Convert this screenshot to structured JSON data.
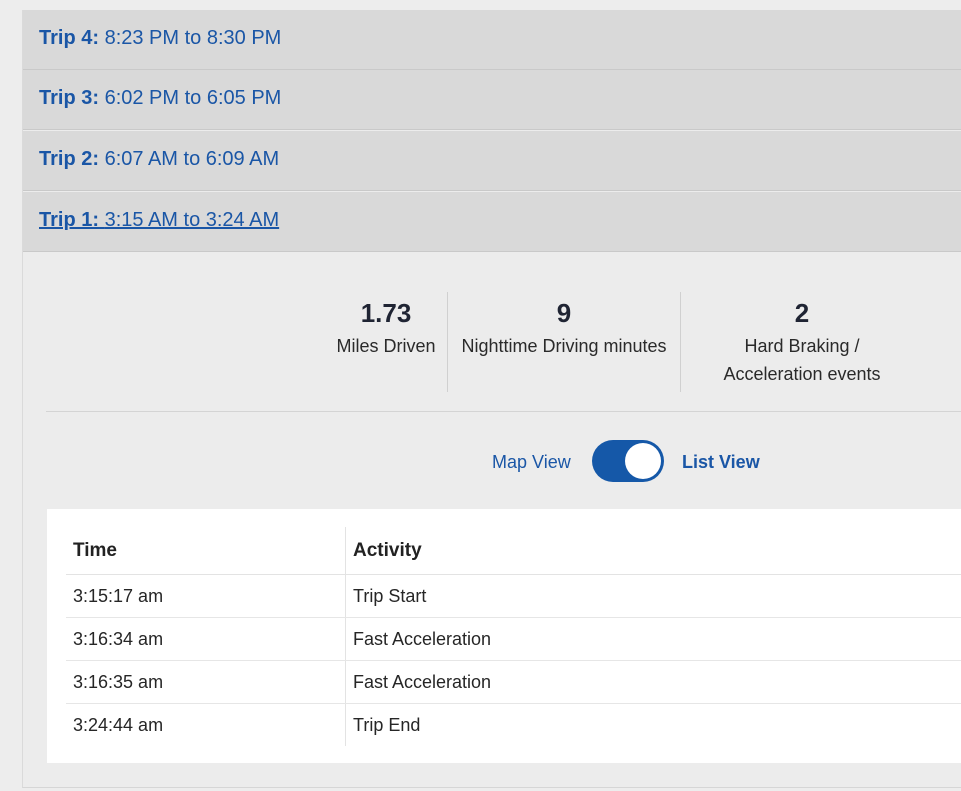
{
  "trips": [
    {
      "name": "Trip 4:",
      "time": "8:23 PM to 8:30 PM"
    },
    {
      "name": "Trip 3:",
      "time": "6:02 PM to 6:05 PM"
    },
    {
      "name": "Trip 2:",
      "time": "6:07 AM to 6:09 AM"
    },
    {
      "name": "Trip 1:",
      "time": "3:15 AM to 3:24 AM"
    }
  ],
  "selected_trip": "Trip 1:",
  "stats": [
    {
      "value": "1.73",
      "caption": "Miles Driven"
    },
    {
      "value": "9",
      "caption": "Nighttime Driving minutes"
    },
    {
      "value": "2",
      "caption_line1": "Hard Braking /",
      "caption_line2": "Acceleration events"
    }
  ],
  "view_toggle": {
    "left_label": "Map View",
    "right_label": "List View",
    "state": "List View"
  },
  "activity_table": {
    "headers": [
      "Time",
      "Activity"
    ],
    "rows": [
      {
        "time": "3:15:17 am",
        "activity": "Trip Start"
      },
      {
        "time": "3:16:34 am",
        "activity": "Fast Acceleration"
      },
      {
        "time": "3:16:35 am",
        "activity": "Fast Acceleration"
      },
      {
        "time": "3:24:44 am",
        "activity": "Trip End"
      }
    ]
  },
  "colors": {
    "accent": "#1558a8",
    "link": "#1a56a6",
    "row_bg": "#d9d9d9",
    "panel_bg": "#ececec"
  }
}
